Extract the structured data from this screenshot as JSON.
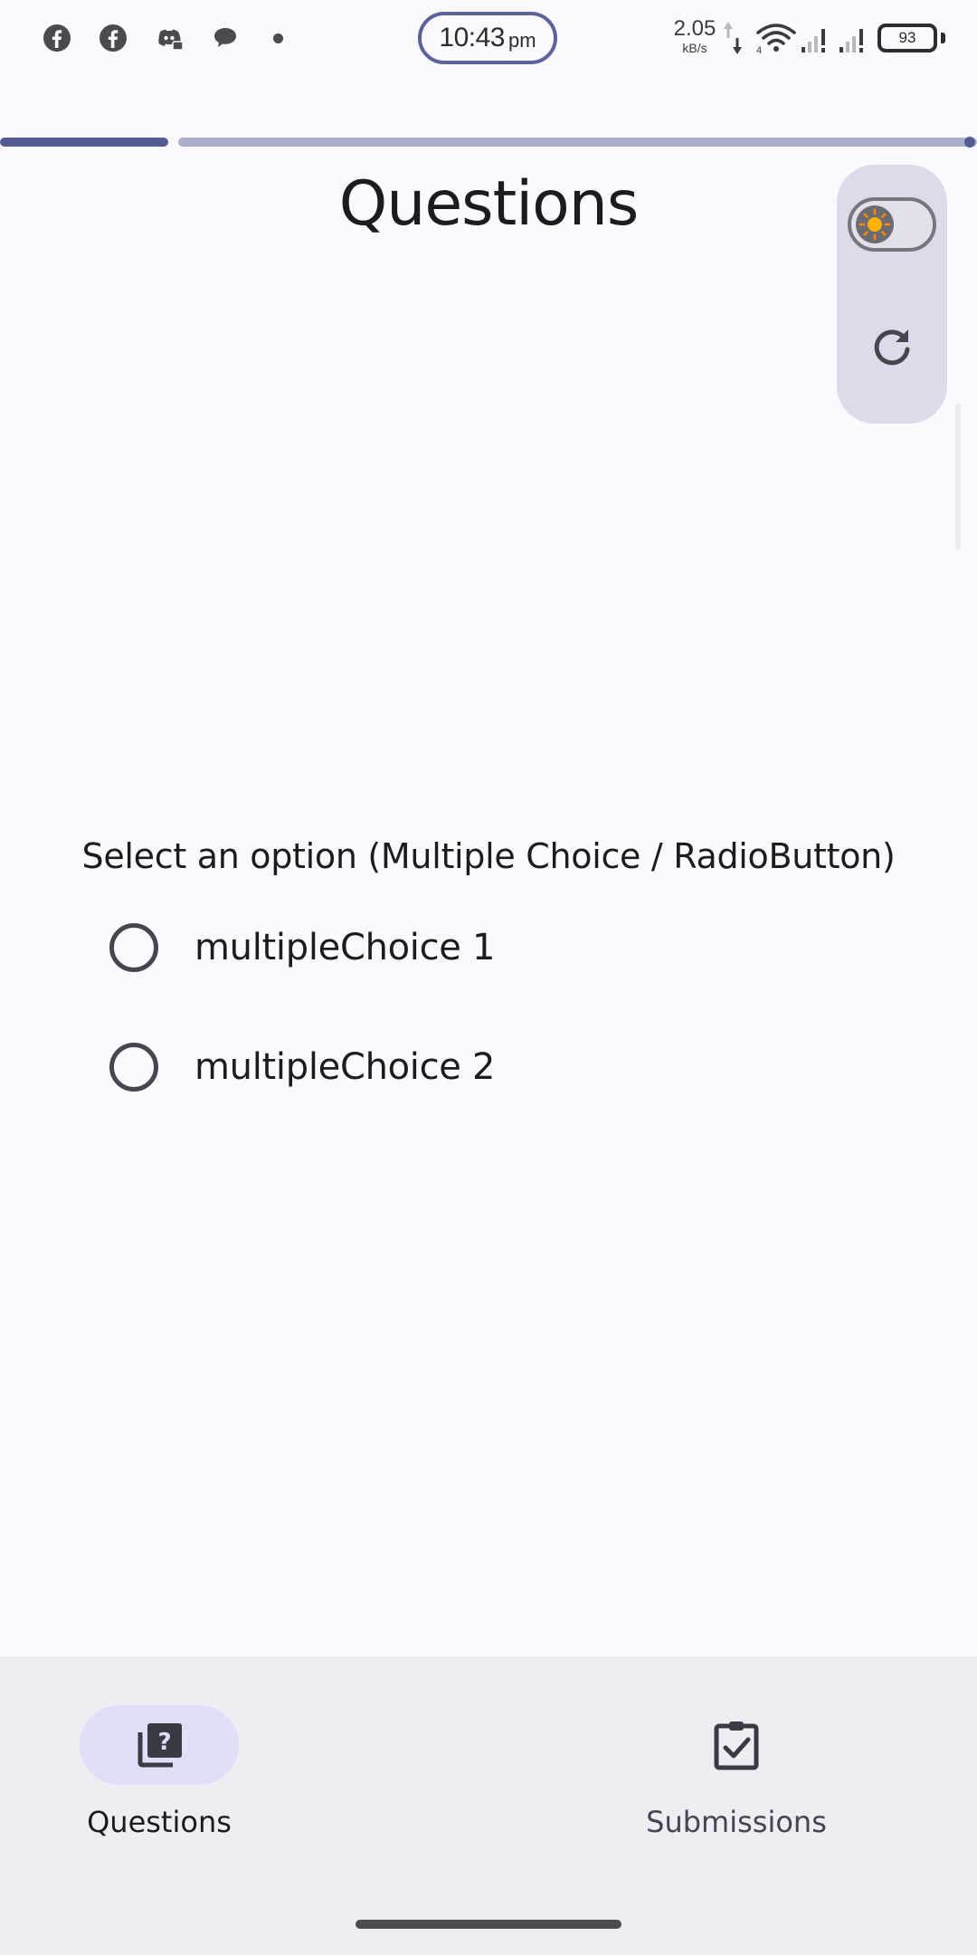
{
  "status_bar": {
    "time": "10:43",
    "ampm": "pm",
    "net_speed_value": "2.05",
    "net_speed_unit": "kB/s",
    "battery": "93",
    "notification_icons": [
      "facebook-icon",
      "facebook-icon",
      "discord-icon",
      "chat-bubble-icon"
    ],
    "system_icons": [
      "data-arrows-icon",
      "wifi-icon",
      "signal-icon",
      "signal-icon",
      "battery-icon"
    ]
  },
  "progress": {
    "fraction": 0.17
  },
  "header": {
    "title": "Questions"
  },
  "side_panel": {
    "theme_toggle_icon": "sun-icon",
    "refresh_icon": "refresh-icon"
  },
  "question": {
    "prompt": "Select an option (Multiple Choice / RadioButton)",
    "options": [
      {
        "label": "multipleChoice 1",
        "selected": false
      },
      {
        "label": "multipleChoice 2",
        "selected": false
      }
    ]
  },
  "bottom_nav": {
    "items": [
      {
        "label": "Questions",
        "icon": "quiz-icon",
        "active": true
      },
      {
        "label": "Submissions",
        "icon": "assignment-check-icon",
        "active": false
      }
    ]
  },
  "colors": {
    "background": "#fcf8ff",
    "primary": "#545a92",
    "nav_background": "#efedf4",
    "active_indicator": "#dfe0f7",
    "panel": "#dddbe9",
    "sun": "#ffb300"
  }
}
